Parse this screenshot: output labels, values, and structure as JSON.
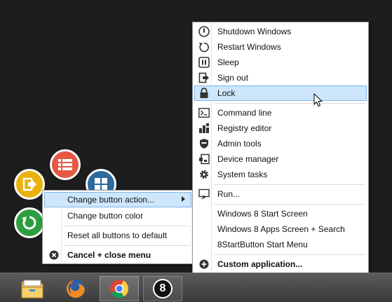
{
  "main_menu": {
    "items": [
      {
        "name": "shutdown",
        "label": "Shutdown Windows",
        "icon": "power-icon"
      },
      {
        "name": "restart",
        "label": "Restart Windows",
        "icon": "restart-icon"
      },
      {
        "name": "sleep",
        "label": "Sleep",
        "icon": "pause-icon"
      },
      {
        "name": "sign-out",
        "label": "Sign out",
        "icon": "sign-out-icon"
      },
      {
        "name": "lock",
        "label": "Lock",
        "icon": "lock-icon",
        "selected": true
      },
      {
        "name": "command-line",
        "label": "Command line",
        "icon": "terminal-icon"
      },
      {
        "name": "registry-editor",
        "label": "Registry editor",
        "icon": "registry-icon"
      },
      {
        "name": "admin-tools",
        "label": "Admin tools",
        "icon": "shield-icon"
      },
      {
        "name": "device-manager",
        "label": "Device manager",
        "icon": "device-icon"
      },
      {
        "name": "system-tasks",
        "label": "System tasks",
        "icon": "gear-icon"
      },
      {
        "name": "run",
        "label": "Run...",
        "icon": "run-icon"
      },
      {
        "name": "win8-start-screen",
        "label": "Windows 8 Start Screen",
        "icon": ""
      },
      {
        "name": "win8-apps-screen",
        "label": "Windows 8 Apps Screen + Search",
        "icon": ""
      },
      {
        "name": "8startbutton-menu",
        "label": "8StartButton Start Menu",
        "icon": ""
      },
      {
        "name": "custom-application",
        "label": "Custom application...",
        "icon": "plus-circle-icon",
        "bold": true
      }
    ]
  },
  "button_menu": {
    "items": [
      {
        "name": "change-button-action",
        "label": "Change button action...",
        "submenu": true,
        "selected": true
      },
      {
        "name": "change-button-color",
        "label": "Change button color"
      },
      {
        "name": "reset-all-buttons",
        "label": "Reset all buttons to default"
      },
      {
        "name": "cancel-close-menu",
        "label": "Cancel + close menu",
        "icon": "close-circle-icon",
        "bold": true
      }
    ]
  },
  "circle_buttons": [
    {
      "name": "sign-out",
      "color": "#e8b30f",
      "icon": "sign-out-icon"
    },
    {
      "name": "menu-list",
      "color": "#e65844",
      "icon": "list-icon"
    },
    {
      "name": "start-screen",
      "color": "#2e6a9e",
      "icon": "windows-icon"
    },
    {
      "name": "restart",
      "color": "#2d9e3f",
      "icon": "restart-icon"
    }
  ],
  "taskbar": {
    "apps": [
      {
        "name": "file-explorer",
        "icon": "folder-icon"
      },
      {
        "name": "firefox",
        "icon": "firefox-icon"
      },
      {
        "name": "chrome",
        "icon": "chrome-icon"
      },
      {
        "name": "8startbutton",
        "icon": "8-icon",
        "label": "8"
      }
    ]
  },
  "colors": {
    "highlight_bg": "#cde6fb",
    "highlight_border": "#7eb4ea",
    "desktop": "#1d1d1d"
  }
}
